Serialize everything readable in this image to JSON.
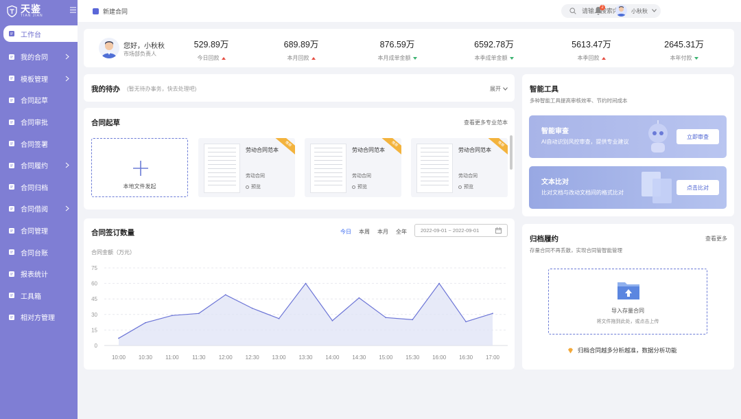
{
  "app": {
    "logo_title": "天鉴",
    "logo_sub": "TIAN JIAN"
  },
  "sidebar": {
    "items": [
      {
        "label": "工作台",
        "icon": "desktop-icon",
        "active": true,
        "arrow": false
      },
      {
        "label": "我的合同",
        "icon": "document-icon",
        "arrow": true
      },
      {
        "label": "模板管理",
        "icon": "template-icon",
        "arrow": true
      },
      {
        "label": "合同起草",
        "icon": "edit-icon",
        "arrow": false
      },
      {
        "label": "合同审批",
        "icon": "approval-icon",
        "arrow": false
      },
      {
        "label": "合同签署",
        "icon": "sign-icon",
        "arrow": false
      },
      {
        "label": "合同履约",
        "icon": "performance-icon",
        "arrow": true
      },
      {
        "label": "合同归档",
        "icon": "archive-icon",
        "arrow": false
      },
      {
        "label": "合同借阅",
        "icon": "borrow-icon",
        "arrow": true
      },
      {
        "label": "合同管理",
        "icon": "manage-icon",
        "arrow": false
      },
      {
        "label": "合同台账",
        "icon": "ledger-icon",
        "arrow": false
      },
      {
        "label": "报表统计",
        "icon": "report-icon",
        "arrow": false
      },
      {
        "label": "工具箱",
        "icon": "toolbox-icon",
        "arrow": false
      },
      {
        "label": "相对方管理",
        "icon": "counterparty-icon",
        "arrow": false
      }
    ]
  },
  "topbar": {
    "page_tag": "新建合同",
    "search_placeholder": "请输入搜索内容",
    "notif_count": "2",
    "user_name": "小秋秋"
  },
  "greeting": {
    "name": "您好，小秋秋",
    "role": "市场部负责人"
  },
  "stats": [
    {
      "value": "529.89万",
      "label": "今日回款",
      "trend": "up"
    },
    {
      "value": "689.89万",
      "label": "本月回款",
      "trend": "up"
    },
    {
      "value": "876.59万",
      "label": "本月成单金额",
      "trend": "down"
    },
    {
      "value": "6592.78万",
      "label": "本季成单金额",
      "trend": "down"
    },
    {
      "value": "5613.47万",
      "label": "本季回款",
      "trend": "up"
    },
    {
      "value": "2645.31万",
      "label": "本年付款",
      "trend": "down"
    }
  ],
  "todo": {
    "title": "我的待办",
    "hint": "(暂无待办事务，快去处理吧)",
    "expand": "展开"
  },
  "draft": {
    "title": "合同起草",
    "more": "查看更多专业范本",
    "upload_label": "本地文件发起",
    "templates": [
      {
        "title": "劳动合同范本",
        "type": "劳动合同",
        "status": "预览",
        "ribbon": "推荐"
      },
      {
        "title": "劳动合同范本",
        "type": "劳动合同",
        "status": "预览",
        "ribbon": "推荐"
      },
      {
        "title": "劳动合同范本",
        "type": "劳动合同",
        "status": "预览",
        "ribbon": "推荐"
      }
    ]
  },
  "chart_card": {
    "title": "合同签订数量",
    "tabs": [
      "今日",
      "本周",
      "本月",
      "全年"
    ],
    "date_range": "2022-09-01 ~ 2022-09-01",
    "unit": "合同金额（万元）"
  },
  "chart_data": {
    "type": "area",
    "x": [
      "10:00",
      "10:30",
      "11:00",
      "11:30",
      "12:00",
      "12:30",
      "13:00",
      "13:30",
      "14:00",
      "14:30",
      "15:00",
      "15:30",
      "16:00",
      "16:30",
      "17:00"
    ],
    "values": [
      7,
      22,
      29,
      31,
      49,
      36,
      26,
      60,
      24,
      46,
      27,
      25,
      60,
      23,
      31
    ],
    "yticks": [
      0,
      15,
      30,
      45,
      60,
      75
    ],
    "ylim": [
      0,
      75
    ],
    "grid": true,
    "line_color": "#6b74d6",
    "fill_color": "#dfe3f6"
  },
  "tools": {
    "title": "智能工具",
    "sub": "多种智能工具提高审核效率、节约时间成本",
    "items": [
      {
        "name": "智能审查",
        "desc": "AI自动识别风控审查，提供专业建议",
        "button": "立即审查"
      },
      {
        "name": "文本比对",
        "desc": "比对文档与改动文档间的格式比对",
        "button": "点击比对"
      }
    ]
  },
  "archive": {
    "title": "归档履约",
    "more": "查看更多",
    "sub": "存量合同不再丢散，实现合同管智能管理",
    "drop_label": "导入存量合同",
    "drop_hint": "将文件拖到此处，或点击上传",
    "tip": "归档合同越多分析越准，数据分析功能"
  },
  "colors": {
    "sidebar": "#7f7ed4",
    "accent": "#3c6cf0",
    "up": "#e54d42",
    "down": "#3cb371"
  }
}
